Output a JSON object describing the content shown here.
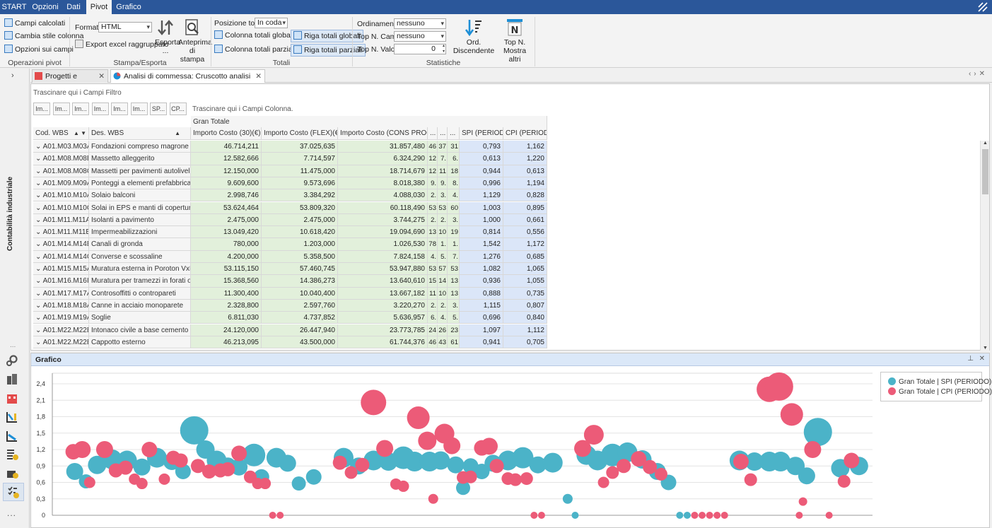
{
  "ribbon_tabs": [
    "START",
    "Opzioni",
    "Dati",
    "Pivot",
    "Grafico"
  ],
  "ribbon": {
    "op_pivot": {
      "campi_calcolati": "Campi calcolati",
      "cambia_stile": "Cambia stile colonna",
      "opzioni_campi": "Opzioni sui campi",
      "label": "Operazioni pivot"
    },
    "stampa": {
      "formato_label": "Formato",
      "formato_value": "HTML",
      "export": "Export excel raggruppato",
      "esporta": "Esporta",
      "esporta2": "...",
      "anteprima": "Anteprima",
      "anteprima2": "di stampa",
      "label": "Stampa/Esporta"
    },
    "totali": {
      "posizione_label": "Posizione totali",
      "posizione_value": "In coda",
      "col_globali": "Colonna totali globali",
      "col_parziali": "Colonna totali parziali",
      "riga_globali": "Riga totali globali",
      "riga_parziali": "Riga totali parziali",
      "label": "Totali"
    },
    "statistiche": {
      "ordinamento_label": "Ordinamento",
      "ordinamento_value": "nessuno",
      "topn_campo_label": "Top N. Campo",
      "topn_campo_value": "nessuno",
      "topn_valori_label": "Top N. Valori",
      "topn_valori_value": "0",
      "ord_disc": "Ord. Discendente",
      "topn": "Top N.",
      "mostra_altri": "Mostra altri",
      "label": "Statistiche"
    }
  },
  "sidebar": {
    "vertical_label": "Contabilità industriale",
    "more": "..."
  },
  "doc_tabs": [
    "Progetti e commesse",
    "Analisi di commessa: Cruscotto analisi scostamenti"
  ],
  "pivot": {
    "filter_drop": "Trascinare qui i Campi Filtro",
    "column_drop": "Trascinare qui i Campi Colonna.",
    "field_buttons": [
      "Im...",
      "Im...",
      "Im...",
      "Im...",
      "Im...",
      "Im...",
      "SP...",
      "CP..."
    ],
    "gran_totale": "Gran Totale",
    "row_headers": [
      "Cod. WBS",
      "Des. WBS"
    ],
    "col_headers": [
      "Importo Costo (30)(€)",
      "Importo Costo (FLEX)(€)",
      "Importo Costo (CONS PROG)(€)",
      "...",
      "...",
      "...",
      "SPI (PERIODO)",
      "CPI (PERIODO)"
    ],
    "rows": [
      {
        "cod": "A01.M03.M03A",
        "des": "Fondazioni compreso magrone e sola...",
        "c30": "46.714,211",
        "flex": "37.025,635",
        "cons": "31.857,480",
        "n1": "46",
        "n2": "37",
        "n3": "31",
        "spi": "0,793",
        "cpi": "1,162"
      },
      {
        "cod": "A01.M08.M08B",
        "des": "Massetto alleggerito",
        "c30": "12.582,666",
        "flex": "7.714,597",
        "cons": "6.324,290",
        "n1": "12",
        "n2": "7.",
        "n3": "6.",
        "spi": "0,613",
        "cpi": "1,220"
      },
      {
        "cod": "A01.M08.M08C",
        "des": "Massetti per pavimenti autolivellanti",
        "c30": "12.150,000",
        "flex": "11.475,000",
        "cons": "18.714,679",
        "n1": "12",
        "n2": "11",
        "n3": "18",
        "spi": "0,944",
        "cpi": "0,613"
      },
      {
        "cod": "A01.M09.M09A",
        "des": "Ponteggi a elementi prefabbricati",
        "c30": "9.609,600",
        "flex": "9.573,696",
        "cons": "8.018,380",
        "n1": "9.",
        "n2": "9.",
        "n3": "8.",
        "spi": "0,996",
        "cpi": "1,194"
      },
      {
        "cod": "A01.M10.M10A",
        "des": "Solaio balconi",
        "c30": "2.998,746",
        "flex": "3.384,292",
        "cons": "4.088,030",
        "n1": "2.",
        "n2": "3.",
        "n3": "4.",
        "spi": "1,129",
        "cpi": "0,828"
      },
      {
        "cod": "A01.M10.M10C",
        "des": "Solai in EPS e manti di copertura",
        "c30": "53.624,464",
        "flex": "53.809,320",
        "cons": "60.118,490",
        "n1": "53",
        "n2": "53",
        "n3": "60",
        "spi": "1,003",
        "cpi": "0,895"
      },
      {
        "cod": "A01.M11.M11A",
        "des": "Isolanti a pavimento",
        "c30": "2.475,000",
        "flex": "2.475,000",
        "cons": "3.744,275",
        "n1": "2.",
        "n2": "2.",
        "n3": "3.",
        "spi": "1,000",
        "cpi": "0,661"
      },
      {
        "cod": "A01.M11.M11B",
        "des": "Impermeabilizzazioni",
        "c30": "13.049,420",
        "flex": "10.618,420",
        "cons": "19.094,690",
        "n1": "13",
        "n2": "10",
        "n3": "19",
        "spi": "0,814",
        "cpi": "0,556"
      },
      {
        "cod": "A01.M14.M14B",
        "des": "Canali di gronda",
        "c30": "780,000",
        "flex": "1.203,000",
        "cons": "1.026,530",
        "n1": "78",
        "n2": "1.",
        "n3": "1.",
        "spi": "1,542",
        "cpi": "1,172"
      },
      {
        "cod": "A01.M14.M14C",
        "des": "Converse e scossaline",
        "c30": "4.200,000",
        "flex": "5.358,500",
        "cons": "7.824,158",
        "n1": "4.",
        "n2": "5.",
        "n3": "7.",
        "spi": "1,276",
        "cpi": "0,685"
      },
      {
        "cod": "A01.M15.M15A",
        "des": "Muratura esterna in Poroton VxP",
        "c30": "53.115,150",
        "flex": "57.460,745",
        "cons": "53.947,880",
        "n1": "53",
        "n2": "57",
        "n3": "53",
        "spi": "1,082",
        "cpi": "1,065"
      },
      {
        "cod": "A01.M16.M16I",
        "des": "Muratura per tramezzi in forati o altro",
        "c30": "15.368,560",
        "flex": "14.386,273",
        "cons": "13.640,610",
        "n1": "15",
        "n2": "14",
        "n3": "13",
        "spi": "0,936",
        "cpi": "1,055"
      },
      {
        "cod": "A01.M17.M17A",
        "des": "Controsoffitti o contropareti",
        "c30": "11.300,400",
        "flex": "10.040,400",
        "cons": "13.667,182",
        "n1": "11",
        "n2": "10",
        "n3": "13",
        "spi": "0,888",
        "cpi": "0,735"
      },
      {
        "cod": "A01.M18.M18A",
        "des": "Canne in acciaio monoparete",
        "c30": "2.328,800",
        "flex": "2.597,760",
        "cons": "3.220,270",
        "n1": "2.",
        "n2": "2.",
        "n3": "3.",
        "spi": "1,115",
        "cpi": "0,807"
      },
      {
        "cod": "A01.M19.M19A",
        "des": "Soglie",
        "c30": "6.811,030",
        "flex": "4.737,852",
        "cons": "5.636,957",
        "n1": "6.",
        "n2": "4.",
        "n3": "5.",
        "spi": "0,696",
        "cpi": "0,840"
      },
      {
        "cod": "A01.M22.M22B",
        "des": "Intonaco civile a base cemento",
        "c30": "24.120,000",
        "flex": "26.447,940",
        "cons": "23.773,785",
        "n1": "24",
        "n2": "26",
        "n3": "23",
        "spi": "1,097",
        "cpi": "1,112"
      },
      {
        "cod": "A01.M22.M22E",
        "des": "Cappotto esterno",
        "c30": "46.213,095",
        "flex": "43.500,000",
        "cons": "61.744,376",
        "n1": "46",
        "n2": "43",
        "n3": "61",
        "spi": "0,941",
        "cpi": "0,705"
      }
    ]
  },
  "chart_panel": {
    "title": "Grafico"
  },
  "chart_data": {
    "type": "scatter",
    "title": "",
    "xlabel": "",
    "ylabel": "",
    "ylim": [
      0,
      2.4
    ],
    "yticks": [
      "2,4",
      "2,1",
      "1,8",
      "1,5",
      "1,2",
      "0,9",
      "0,6",
      "0,3",
      "0"
    ],
    "ytick_values": [
      2.4,
      2.1,
      1.8,
      1.5,
      1.2,
      0.9,
      0.6,
      0.3,
      0
    ],
    "grid": true,
    "legend_position": "top-right",
    "colors": {
      "spi": "#4bb3c8",
      "cpi": "#ec5b78"
    },
    "series": [
      {
        "name": "Gran Totale | SPI (PERIODO)",
        "color": "#4bb3c8",
        "points": [
          {
            "x": 3,
            "y": 0.8,
            "s": 12
          },
          {
            "x": 4.5,
            "y": 0.62,
            "s": 10
          },
          {
            "x": 6,
            "y": 0.92,
            "s": 13
          },
          {
            "x": 8,
            "y": 1.02,
            "s": 14
          },
          {
            "x": 10,
            "y": 1.0,
            "s": 14
          },
          {
            "x": 12,
            "y": 0.88,
            "s": 12
          },
          {
            "x": 14,
            "y": 1.05,
            "s": 14
          },
          {
            "x": 16,
            "y": 0.98,
            "s": 12
          },
          {
            "x": 17.5,
            "y": 0.8,
            "s": 11
          },
          {
            "x": 19,
            "y": 1.55,
            "s": 20
          },
          {
            "x": 20.5,
            "y": 1.2,
            "s": 13
          },
          {
            "x": 22,
            "y": 1.0,
            "s": 14
          },
          {
            "x": 23.5,
            "y": 0.9,
            "s": 12
          },
          {
            "x": 25,
            "y": 0.88,
            "s": 12
          },
          {
            "x": 27,
            "y": 1.1,
            "s": 16
          },
          {
            "x": 28,
            "y": 0.7,
            "s": 11
          },
          {
            "x": 30,
            "y": 1.05,
            "s": 14
          },
          {
            "x": 31.5,
            "y": 0.95,
            "s": 12
          },
          {
            "x": 33,
            "y": 0.58,
            "s": 10
          },
          {
            "x": 35,
            "y": 0.7,
            "s": 11
          },
          {
            "x": 39,
            "y": 1.05,
            "s": 14
          },
          {
            "x": 41,
            "y": 0.9,
            "s": 12
          },
          {
            "x": 43,
            "y": 1.0,
            "s": 14
          },
          {
            "x": 45,
            "y": 0.98,
            "s": 13
          },
          {
            "x": 47,
            "y": 1.05,
            "s": 16
          },
          {
            "x": 48.5,
            "y": 0.98,
            "s": 14
          },
          {
            "x": 50.5,
            "y": 0.98,
            "s": 14
          },
          {
            "x": 52,
            "y": 1.0,
            "s": 13
          },
          {
            "x": 54,
            "y": 0.92,
            "s": 12
          },
          {
            "x": 55,
            "y": 0.5,
            "s": 10
          },
          {
            "x": 56,
            "y": 0.9,
            "s": 11
          },
          {
            "x": 57.5,
            "y": 0.8,
            "s": 11
          },
          {
            "x": 59,
            "y": 0.95,
            "s": 12
          },
          {
            "x": 61,
            "y": 1.0,
            "s": 14
          },
          {
            "x": 63,
            "y": 1.05,
            "s": 15
          },
          {
            "x": 65,
            "y": 0.92,
            "s": 12
          },
          {
            "x": 67,
            "y": 0.96,
            "s": 14
          },
          {
            "x": 69,
            "y": 0.3,
            "s": 7
          },
          {
            "x": 70,
            "y": 0.0,
            "s": 5
          },
          {
            "x": 71.5,
            "y": 1.1,
            "s": 14
          },
          {
            "x": 73,
            "y": 1.0,
            "s": 14
          },
          {
            "x": 75,
            "y": 1.1,
            "s": 16
          },
          {
            "x": 77,
            "y": 1.15,
            "s": 14
          },
          {
            "x": 79,
            "y": 1.02,
            "s": 13
          },
          {
            "x": 81,
            "y": 0.8,
            "s": 12
          },
          {
            "x": 82.5,
            "y": 0.6,
            "s": 11
          },
          {
            "x": 84,
            "y": 0.0,
            "s": 5
          },
          {
            "x": 85,
            "y": 0.0,
            "s": 5
          },
          {
            "x": 92,
            "y": 1.0,
            "s": 14
          },
          {
            "x": 94,
            "y": 0.98,
            "s": 13
          },
          {
            "x": 96,
            "y": 0.98,
            "s": 14
          },
          {
            "x": 97.5,
            "y": 0.98,
            "s": 14
          },
          {
            "x": 99.5,
            "y": 0.9,
            "s": 13
          },
          {
            "x": 101,
            "y": 0.72,
            "s": 12
          },
          {
            "x": 102.5,
            "y": 1.52,
            "s": 20
          },
          {
            "x": 105.5,
            "y": 0.86,
            "s": 13
          },
          {
            "x": 108,
            "y": 0.9,
            "s": 13
          }
        ]
      },
      {
        "name": "Gran Totale | CPI (PERIODO)",
        "color": "#ec5b78",
        "points": [
          {
            "x": 2.8,
            "y": 1.16,
            "s": 11
          },
          {
            "x": 4,
            "y": 1.2,
            "s": 12
          },
          {
            "x": 5,
            "y": 0.6,
            "s": 8
          },
          {
            "x": 7,
            "y": 1.2,
            "s": 12
          },
          {
            "x": 8.5,
            "y": 0.82,
            "s": 10
          },
          {
            "x": 9.8,
            "y": 0.87,
            "s": 10
          },
          {
            "x": 11,
            "y": 0.66,
            "s": 8
          },
          {
            "x": 12,
            "y": 0.58,
            "s": 8
          },
          {
            "x": 13,
            "y": 1.2,
            "s": 11
          },
          {
            "x": 15,
            "y": 0.66,
            "s": 8
          },
          {
            "x": 16.2,
            "y": 1.05,
            "s": 10
          },
          {
            "x": 17.2,
            "y": 1.0,
            "s": 10
          },
          {
            "x": 19.5,
            "y": 0.9,
            "s": 10
          },
          {
            "x": 21,
            "y": 0.8,
            "s": 10
          },
          {
            "x": 22.5,
            "y": 0.82,
            "s": 10
          },
          {
            "x": 23.5,
            "y": 0.84,
            "s": 10
          },
          {
            "x": 25,
            "y": 1.13,
            "s": 11
          },
          {
            "x": 26.5,
            "y": 0.7,
            "s": 9
          },
          {
            "x": 27.5,
            "y": 0.58,
            "s": 8
          },
          {
            "x": 28.5,
            "y": 0.58,
            "s": 8
          },
          {
            "x": 29.5,
            "y": 0.0,
            "s": 5
          },
          {
            "x": 30.5,
            "y": 0.0,
            "s": 5
          },
          {
            "x": 38.5,
            "y": 0.96,
            "s": 10
          },
          {
            "x": 40,
            "y": 0.78,
            "s": 9
          },
          {
            "x": 41.5,
            "y": 0.92,
            "s": 10
          },
          {
            "x": 43,
            "y": 2.06,
            "s": 18
          },
          {
            "x": 44.5,
            "y": 1.22,
            "s": 12
          },
          {
            "x": 46,
            "y": 0.57,
            "s": 8
          },
          {
            "x": 47,
            "y": 0.53,
            "s": 8
          },
          {
            "x": 49,
            "y": 1.78,
            "s": 16
          },
          {
            "x": 50.2,
            "y": 1.36,
            "s": 13
          },
          {
            "x": 51,
            "y": 0.3,
            "s": 7
          },
          {
            "x": 52.5,
            "y": 1.49,
            "s": 14
          },
          {
            "x": 53.5,
            "y": 1.27,
            "s": 12
          },
          {
            "x": 55,
            "y": 0.69,
            "s": 9
          },
          {
            "x": 56,
            "y": 0.7,
            "s": 9
          },
          {
            "x": 57.5,
            "y": 1.23,
            "s": 11
          },
          {
            "x": 58.5,
            "y": 1.26,
            "s": 12
          },
          {
            "x": 59.5,
            "y": 0.9,
            "s": 10
          },
          {
            "x": 61,
            "y": 0.67,
            "s": 9
          },
          {
            "x": 62,
            "y": 0.65,
            "s": 9
          },
          {
            "x": 63.5,
            "y": 0.67,
            "s": 9
          },
          {
            "x": 64.5,
            "y": 0.0,
            "s": 5
          },
          {
            "x": 65.5,
            "y": 0.0,
            "s": 5
          },
          {
            "x": 71,
            "y": 1.22,
            "s": 12
          },
          {
            "x": 72.5,
            "y": 1.47,
            "s": 14
          },
          {
            "x": 73.8,
            "y": 0.6,
            "s": 8
          },
          {
            "x": 75,
            "y": 0.78,
            "s": 9
          },
          {
            "x": 76.5,
            "y": 0.9,
            "s": 10
          },
          {
            "x": 78.5,
            "y": 1.03,
            "s": 11
          },
          {
            "x": 80,
            "y": 0.88,
            "s": 10
          },
          {
            "x": 81.5,
            "y": 0.75,
            "s": 9
          },
          {
            "x": 86,
            "y": 0.0,
            "s": 5
          },
          {
            "x": 87,
            "y": 0.0,
            "s": 5
          },
          {
            "x": 88,
            "y": 0.0,
            "s": 5
          },
          {
            "x": 89,
            "y": 0.0,
            "s": 5
          },
          {
            "x": 90,
            "y": 0.0,
            "s": 5
          },
          {
            "x": 92.2,
            "y": 0.98,
            "s": 11
          },
          {
            "x": 93.5,
            "y": 0.65,
            "s": 9
          },
          {
            "x": 96,
            "y": 2.3,
            "s": 18
          },
          {
            "x": 97.3,
            "y": 2.35,
            "s": 20
          },
          {
            "x": 99,
            "y": 1.84,
            "s": 16
          },
          {
            "x": 100,
            "y": 0.0,
            "s": 5
          },
          {
            "x": 100.5,
            "y": 0.25,
            "s": 6
          },
          {
            "x": 101.8,
            "y": 1.2,
            "s": 12
          },
          {
            "x": 104,
            "y": 0.0,
            "s": 5
          },
          {
            "x": 106,
            "y": 0.62,
            "s": 9
          },
          {
            "x": 107,
            "y": 1.0,
            "s": 11
          }
        ]
      }
    ]
  }
}
